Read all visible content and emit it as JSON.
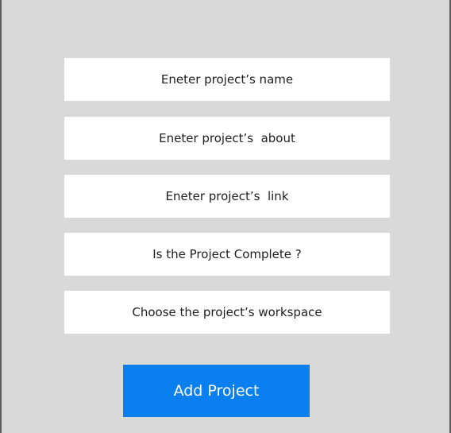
{
  "form": {
    "name_field": {
      "label": "Eneter project’s name"
    },
    "about_field": {
      "label": "Eneter project’s  about"
    },
    "link_field": {
      "label": "Eneter project’s  link"
    },
    "complete_field": {
      "label": "Is the Project Complete ?"
    },
    "workspace_field": {
      "label": "Choose the project’s workspace"
    },
    "submit_label": "Add Project"
  },
  "colors": {
    "background": "#d9d9d9",
    "field_background": "#ffffff",
    "button_background": "#0a7fef",
    "button_text": "#ffffff",
    "text": "#1e1e1e"
  }
}
